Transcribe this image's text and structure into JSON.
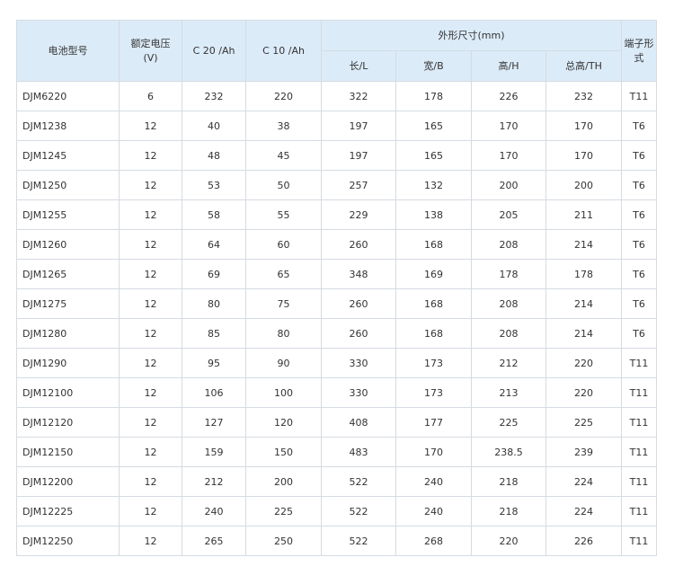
{
  "header": {
    "model": "电池型号",
    "voltage_line1": "额定电压",
    "voltage_line2": "(V)",
    "c20": "C 20 /Ah",
    "c10": "C 10 /Ah",
    "dimensions": "外形尺寸(mm)",
    "length": "长/L",
    "width": "宽/B",
    "height": "高/H",
    "total_height": "总高/TH",
    "terminal_line1": "端子形",
    "terminal_line2": "式"
  },
  "rows": [
    {
      "model": "DJM6220",
      "voltage": "6",
      "c20": "232",
      "c10": "220",
      "length": "322",
      "width": "178",
      "height": "226",
      "total_height": "232",
      "terminal": "T11"
    },
    {
      "model": "DJM1238",
      "voltage": "12",
      "c20": "40",
      "c10": "38",
      "length": "197",
      "width": "165",
      "height": "170",
      "total_height": "170",
      "terminal": "T6"
    },
    {
      "model": "DJM1245",
      "voltage": "12",
      "c20": "48",
      "c10": "45",
      "length": "197",
      "width": "165",
      "height": "170",
      "total_height": "170",
      "terminal": "T6"
    },
    {
      "model": "DJM1250",
      "voltage": "12",
      "c20": "53",
      "c10": "50",
      "length": "257",
      "width": "132",
      "height": "200",
      "total_height": "200",
      "terminal": "T6"
    },
    {
      "model": "DJM1255",
      "voltage": "12",
      "c20": "58",
      "c10": "55",
      "length": "229",
      "width": "138",
      "height": "205",
      "total_height": "211",
      "terminal": "T6"
    },
    {
      "model": "DJM1260",
      "voltage": "12",
      "c20": "64",
      "c10": "60",
      "length": "260",
      "width": "168",
      "height": "208",
      "total_height": "214",
      "terminal": "T6"
    },
    {
      "model": "DJM1265",
      "voltage": "12",
      "c20": "69",
      "c10": "65",
      "length": "348",
      "width": "169",
      "height": "178",
      "total_height": "178",
      "terminal": "T6"
    },
    {
      "model": "DJM1275",
      "voltage": "12",
      "c20": "80",
      "c10": "75",
      "length": "260",
      "width": "168",
      "height": "208",
      "total_height": "214",
      "terminal": "T6"
    },
    {
      "model": "DJM1280",
      "voltage": "12",
      "c20": "85",
      "c10": "80",
      "length": "260",
      "width": "168",
      "height": "208",
      "total_height": "214",
      "terminal": "T6"
    },
    {
      "model": "DJM1290",
      "voltage": "12",
      "c20": "95",
      "c10": "90",
      "length": "330",
      "width": "173",
      "height": "212",
      "total_height": "220",
      "terminal": "T11"
    },
    {
      "model": "DJM12100",
      "voltage": "12",
      "c20": "106",
      "c10": "100",
      "length": "330",
      "width": "173",
      "height": "213",
      "total_height": "220",
      "terminal": "T11"
    },
    {
      "model": "DJM12120",
      "voltage": "12",
      "c20": "127",
      "c10": "120",
      "length": "408",
      "width": "177",
      "height": "225",
      "total_height": "225",
      "terminal": "T11"
    },
    {
      "model": "DJM12150",
      "voltage": "12",
      "c20": "159",
      "c10": "150",
      "length": "483",
      "width": "170",
      "height": "238.5",
      "total_height": "239",
      "terminal": "T11"
    },
    {
      "model": "DJM12200",
      "voltage": "12",
      "c20": "212",
      "c10": "200",
      "length": "522",
      "width": "240",
      "height": "218",
      "total_height": "224",
      "terminal": "T11"
    },
    {
      "model": "DJM12225",
      "voltage": "12",
      "c20": "240",
      "c10": "225",
      "length": "522",
      "width": "240",
      "height": "218",
      "total_height": "224",
      "terminal": "T11"
    },
    {
      "model": "DJM12250",
      "voltage": "12",
      "c20": "265",
      "c10": "250",
      "length": "522",
      "width": "268",
      "height": "220",
      "total_height": "226",
      "terminal": "T11"
    }
  ]
}
